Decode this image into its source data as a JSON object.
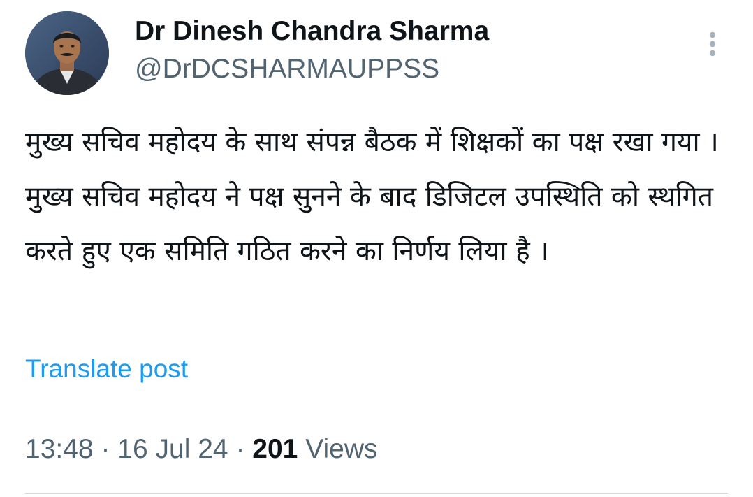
{
  "author": {
    "display_name": "Dr Dinesh Chandra Sharma",
    "handle": "@DrDCSHARMAUPPSS",
    "avatar_icon": "profile-photo"
  },
  "post": {
    "text": "मुख्य सचिव महोदय के साथ संपन्न बैठक में शिक्षकों का पक्ष रखा गया ।मुख्य सचिव महोदय ने पक्ष सुनने के बाद डिजिटल उपस्थिति को स्थगित करते हुए एक समिति गठित करने का निर्णय लिया है ।",
    "translate_label": "Translate post"
  },
  "meta": {
    "time": "13:48",
    "separator": "·",
    "date": "16 Jul 24",
    "views_count": "201",
    "views_label": "Views"
  },
  "colors": {
    "text_primary": "#0f1419",
    "text_secondary": "#536471",
    "link": "#1d9bf0",
    "divider": "#cfd9de"
  },
  "icons": {
    "more": "more-vertical-icon"
  }
}
